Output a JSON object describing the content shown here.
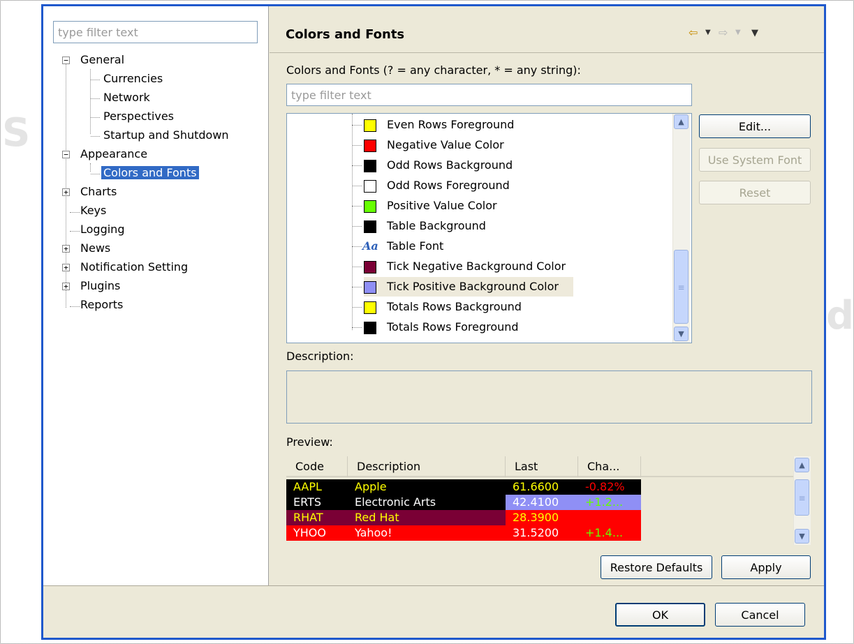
{
  "left_filter": {
    "placeholder": "type filter text"
  },
  "tree": {
    "general": "General",
    "currencies": "Currencies",
    "network": "Network",
    "perspectives": "Perspectives",
    "startup": "Startup and Shutdown",
    "appearance": "Appearance",
    "colors_fonts": "Colors and Fonts",
    "charts": "Charts",
    "keys": "Keys",
    "logging": "Logging",
    "news": "News",
    "notification": "Notification Setting",
    "plugins": "Plugins",
    "reports": "Reports",
    "expand_minus": "−",
    "expand_plus": "+"
  },
  "header": {
    "title": "Colors and Fonts",
    "back_icon": "⇦",
    "forward_icon": "⇨",
    "drop_icon": "▼",
    "menu_icon": "▼"
  },
  "colors_fonts_label": "Colors and Fonts (? = any character, * = any string):",
  "cf_filter": {
    "placeholder": "type filter text"
  },
  "list_items": [
    {
      "label": "Even Rows Foreground",
      "color": "#ffff00"
    },
    {
      "label": "Negative Value Color",
      "color": "#ff0000"
    },
    {
      "label": "Odd Rows Background",
      "color": "#000000"
    },
    {
      "label": "Odd Rows Foreground",
      "color": "#ffffff"
    },
    {
      "label": "Positive Value Color",
      "color": "#66ff00"
    },
    {
      "label": "Table Background",
      "color": "#000000"
    },
    {
      "label": "Table Font",
      "icon": "Aa"
    },
    {
      "label": "Tick Negative Background Color",
      "color": "#7a0035"
    },
    {
      "label": "Tick Positive Background Color",
      "color": "#8f8ff5"
    },
    {
      "label": "Totals Rows Background",
      "color": "#ffff00"
    },
    {
      "label": "Totals Rows Foreground",
      "color": "#000000"
    }
  ],
  "buttons": {
    "edit": "Edit...",
    "use_system_font": "Use System Font",
    "reset": "Reset",
    "restore_defaults": "Restore Defaults",
    "apply": "Apply",
    "ok": "OK",
    "cancel": "Cancel"
  },
  "description_label": "Description:",
  "preview_label": "Preview:",
  "preview": {
    "columns": [
      "Code",
      "Description",
      "Last",
      "Cha..."
    ],
    "rows": [
      {
        "code": "AAPL",
        "desc": "Apple",
        "last": "61.6600",
        "change": "-0.82%"
      },
      {
        "code": "ERTS",
        "desc": "Electronic Arts",
        "last": "42.4100",
        "change": "+1.2..."
      },
      {
        "code": "RHAT",
        "desc": "Red Hat",
        "last": "28.3900",
        "change": ""
      },
      {
        "code": "YHOO",
        "desc": "Yahoo!",
        "last": "31.5200",
        "change": "+1.4..."
      }
    ]
  },
  "scroll_icons": {
    "up": "▲",
    "down": "▼",
    "grip": "≡"
  }
}
